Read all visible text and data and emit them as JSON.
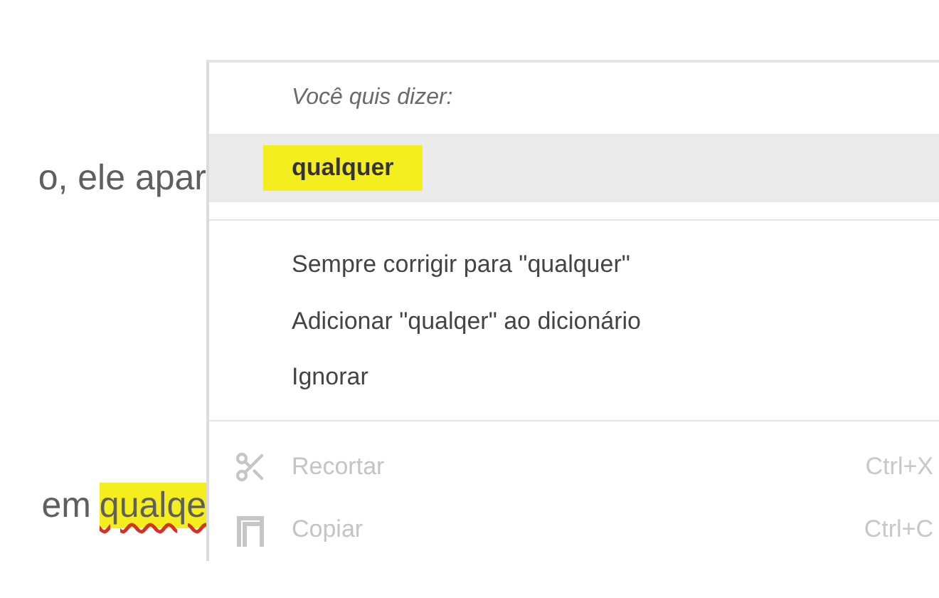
{
  "document": {
    "lines": [
      {
        "segments": [
          {
            "text": "o, ele apar",
            "misspelled": false,
            "highlighted": false
          }
        ]
      },
      {
        "segments": [
          {
            "text": "em",
            "misspelled": false,
            "highlighted": false
          },
          {
            "text": "qualqe",
            "misspelled": true,
            "highlighted": true
          }
        ]
      }
    ]
  },
  "context_menu": {
    "header": "Você quis dizer:",
    "suggestions": [
      {
        "label": "qualquer",
        "selected": true,
        "highlighted": true
      }
    ],
    "actions": [
      {
        "label": "Sempre corrigir para \"qualquer\""
      },
      {
        "label": "Adicionar \"qualqer\" ao dicionário"
      },
      {
        "label": "Ignorar"
      }
    ],
    "edit_items": [
      {
        "kind": "cut",
        "label": "Recortar",
        "shortcut": "Ctrl+X",
        "disabled": true
      },
      {
        "kind": "copy",
        "label": "Copiar",
        "shortcut": "Ctrl+C",
        "disabled": true
      }
    ]
  }
}
